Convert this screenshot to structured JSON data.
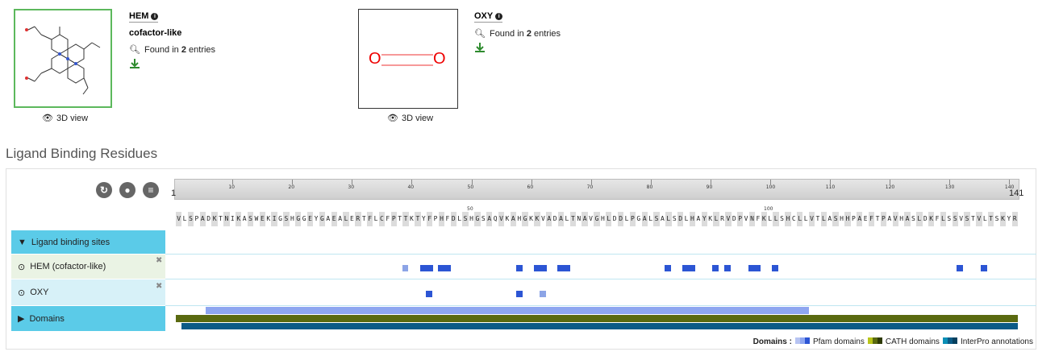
{
  "ligands": [
    {
      "code": "HEM",
      "type": "cofactor-like",
      "found_prefix": "Found in ",
      "found_count": "2",
      "found_suffix": " entries",
      "view_label": "3D view"
    },
    {
      "code": "OXY",
      "type": "",
      "found_prefix": "Found in ",
      "found_count": "2",
      "found_suffix": " entries",
      "view_label": "3D view",
      "atom_label": "O"
    }
  ],
  "section_title": "Ligand Binding Residues",
  "ruler": {
    "start": "1",
    "end": "141",
    "ticks": [
      "10",
      "20",
      "30",
      "40",
      "50",
      "60",
      "70",
      "80",
      "90",
      "100",
      "110",
      "120",
      "130",
      "140"
    ]
  },
  "sequence": "VLSPADKTNIKASWEKIGSHGGEYGAEALERTFLCFPTTKTYFPHFDLSHGSAQVKAHGKKVADALTNAVGHLDDLPGALSALSDLHAYKLRVDPVNFKLLSHCLLVTLASHHPAEFTPAVHASLDKFLSSVSTVLTSKYR",
  "seq_markers": [
    "50",
    "100"
  ],
  "tracks": {
    "group_label": "Ligand binding sites",
    "hem_label": "HEM (cofactor-like)",
    "oxy_label": "OXY",
    "domains_label": "Domains"
  },
  "legend": {
    "title": "Domains :",
    "pfam": "Pfam domains",
    "cath": "CATH domains",
    "interpro": "InterPro annotations"
  },
  "colors": {
    "accent_green": "#5cb85c",
    "track_bg": "#5bcbe8",
    "feature_blue": "#2c55d4",
    "feature_light": "#8ca4e6",
    "pfam": "#8ea6f0",
    "cath": "#5a6a10",
    "interpro": "#0b5a86"
  }
}
